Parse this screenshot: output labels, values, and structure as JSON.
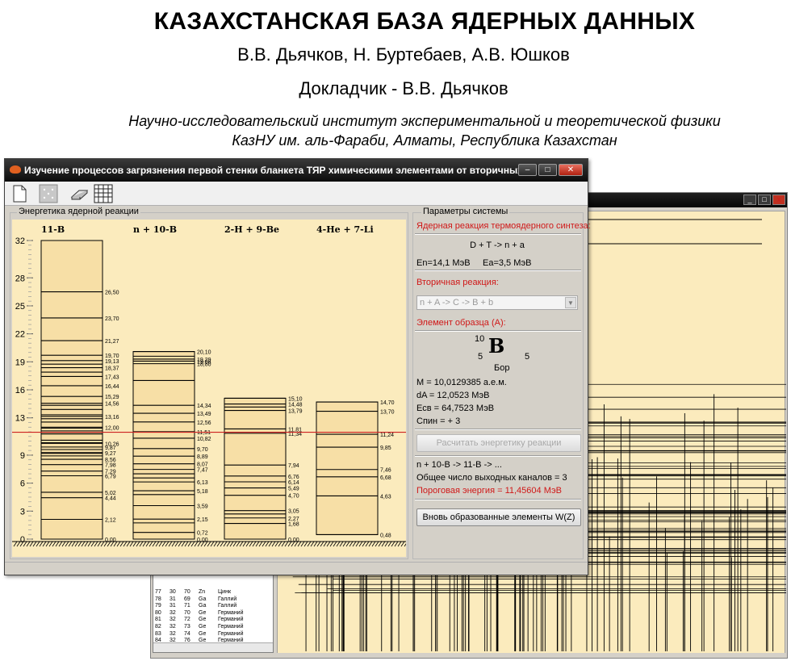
{
  "slide": {
    "title": "КАЗАХСТАНСКАЯ БАЗА ЯДЕРНЫХ ДАННЫХ",
    "authors": "В.В. Дьячков, Н. Буртебаев, А.В. Юшков",
    "speaker": "Докладчик  - В.В. Дьячков",
    "institute": "Научно-исследовательский институт экспериментальной и теоретической физики",
    "affiliation": "КазНУ им. аль-Фараби, Алматы, Республика Казахстан"
  },
  "window": {
    "title": "Изучение процессов загрязнения первой стенки бланкета ТЯР химическими элементами от вторичных ...",
    "controls": {
      "minimize": "–",
      "maximize": "□",
      "close": "✕"
    }
  },
  "toolbar": {
    "icons": [
      "new-document-icon",
      "dots-grid-icon",
      "eraser-icon",
      "table-grid-icon"
    ]
  },
  "chart_data": {
    "type": "table",
    "title": "Энергетика ядерной реакции",
    "ylabel": "",
    "ylim": [
      0,
      32
    ],
    "y_ticks": [
      0,
      3,
      6,
      9,
      13,
      16,
      19,
      22,
      25,
      28,
      32
    ],
    "threshold_energy": 11.456,
    "columns": [
      {
        "name": "11-B",
        "top": 32,
        "levels": [
          0.0,
          2.12,
          4.44,
          5.02,
          6.79,
          7.29,
          7.98,
          8.56,
          8.92,
          9.19,
          9.27,
          9.6,
          9.87,
          10.26,
          10.33,
          10.6,
          11.27,
          11.44,
          11.6,
          11.9,
          12.0,
          12.55,
          12.9,
          13.16,
          13.33,
          13.9,
          14.34,
          14.56,
          15.29,
          16.44,
          17.43,
          17.9,
          18.37,
          18.75,
          19.13,
          19.7,
          21.27,
          23.7,
          26.5
        ],
        "labels": [
          "0,00",
          "2,12",
          "4,44",
          "5,02",
          "6,79",
          "7,29",
          "7,98",
          "8,56",
          "9,27",
          "9,87",
          "10,26",
          "12,00",
          "13,16",
          "14,56",
          "15,29",
          "16,44",
          "17,43",
          "18,37",
          "19,13",
          "19,70",
          "21,27",
          "23,70",
          "26,50"
        ]
      },
      {
        "name": "n + 10-B",
        "top": 20.1,
        "levels": [
          0.0,
          0.72,
          1.74,
          2.15,
          3.59,
          4.77,
          5.18,
          6.13,
          6.56,
          7.0,
          7.47,
          8.07,
          8.89,
          9.7,
          10.82,
          11.51,
          12.56,
          13.49,
          14.34,
          17.0,
          18.8,
          19.08,
          19.29,
          19.6,
          20.1
        ],
        "labels": [
          "0,00",
          "0,72",
          "2,15",
          "3,59",
          "5,18",
          "6,13",
          "7,47",
          "8,07",
          "8,89",
          "9,70",
          "10,82",
          "11,51",
          "12,56",
          "13,49",
          "14,34",
          "18,80",
          "19,08",
          "19,29",
          "20,10"
        ]
      },
      {
        "name": "2-H + 9-Be",
        "top": 15.1,
        "levels": [
          0.0,
          1.68,
          2.27,
          2.7,
          3.05,
          4.7,
          5.49,
          6.14,
          6.76,
          7.94,
          11.34,
          11.81,
          13.79,
          14.16,
          14.48,
          15.1
        ],
        "labels": [
          "0,00",
          "1,68",
          "2,27",
          "3,05",
          "4,70",
          "5,49",
          "6,14",
          "6,76",
          "7,94",
          "11,34",
          "11,81",
          "13,79",
          "14,48",
          "15,10"
        ]
      },
      {
        "name": "4-He + 7-Li",
        "top": 14.7,
        "levels": [
          0.48,
          4.63,
          6.68,
          7.46,
          9.85,
          11.24,
          13.7,
          14.7
        ],
        "labels": [
          "0,48",
          "4,63",
          "6,68",
          "7,46",
          "9,85",
          "11,24",
          "13,70",
          "14,70"
        ]
      }
    ]
  },
  "panel": {
    "group_title": "Параметры системы",
    "fusion_title": "Ядерная реакция термоядерного синтеза:",
    "fusion_reaction": "D + T -> n + a",
    "fusion_energy_n": "En=14,1 МэВ",
    "fusion_energy_a": "Ea=3,5 МэВ",
    "secondary_title": "Вторичная реакция:",
    "secondary_value": "n + A -> C -> B + b",
    "element_title": "Элемент образца (А):",
    "element_mass_number": "10",
    "element_z": "5",
    "element_symbol": "B",
    "element_n": "5",
    "element_name": "Бор",
    "mass": "M = 10,0129385 а.е.м.",
    "mass_defect": "dA = 12,0523 МэВ",
    "binding_energy": "Есв = 64,7523 МэВ",
    "spin": "Спин = + 3",
    "calc_button": "Расчитать энергетику реакции",
    "result_reaction": "n + 10-B -> 11-B -> ...",
    "channels": "Общее число выходных каналов = 3",
    "threshold": "Пороговая энергия = 11,45604 МэВ",
    "elements_button": "Вновь образованные элементы W(Z)"
  },
  "bg_table": {
    "rows": [
      [
        "77",
        "30",
        "70",
        "Zn",
        "Цинк"
      ],
      [
        "78",
        "31",
        "69",
        "Ga",
        "Галлий"
      ],
      [
        "79",
        "31",
        "71",
        "Ga",
        "Галлий"
      ],
      [
        "80",
        "32",
        "70",
        "Ge",
        "Германий"
      ],
      [
        "81",
        "32",
        "72",
        "Ge",
        "Германий"
      ],
      [
        "82",
        "32",
        "73",
        "Ge",
        "Германий"
      ],
      [
        "83",
        "32",
        "74",
        "Ge",
        "Германий"
      ],
      [
        "84",
        "32",
        "76",
        "Ge",
        "Германий"
      ]
    ]
  },
  "colors": {
    "chart_bg": "#fbebbd",
    "column_fill": "#f7dfa6",
    "threshold_line": "#cc2020",
    "red_text": "#d01818"
  }
}
